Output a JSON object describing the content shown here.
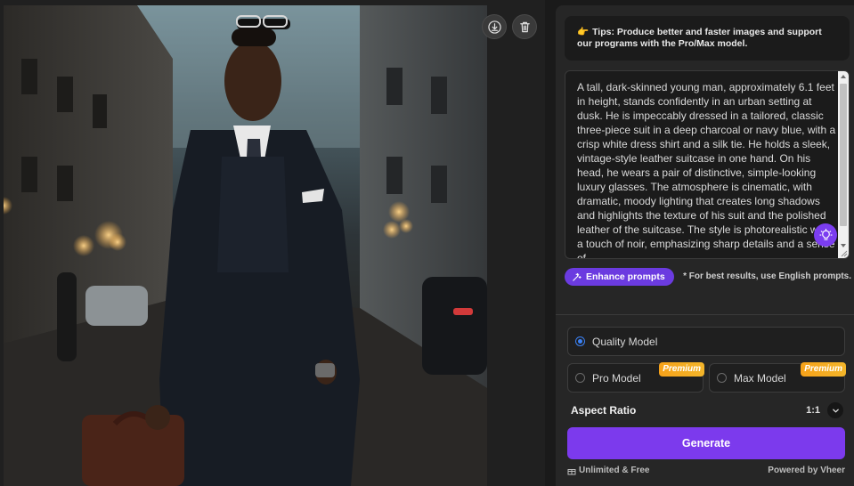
{
  "image": {
    "actions": {
      "download_icon": "download-icon",
      "delete_icon": "trash-icon"
    }
  },
  "tips": {
    "icon": "👉",
    "text": "Tips: Produce better and faster images and support our programs with the Pro/Max model."
  },
  "prompt": {
    "value": "A tall, dark-skinned young man, approximately 6.1 feet in height, stands confidently in an urban setting at dusk. He is impeccably dressed in a tailored, classic three-piece suit in a deep charcoal or navy blue, with a crisp white dress shirt and a silk tie. He holds a sleek, vintage-style leather suitcase in one hand. On his head, he wears a pair of distinctive, simple-looking luxury glasses. The atmosphere is cinematic, with dramatic, moody lighting that creates long shadows and highlights the texture of his suit and the polished leather of the suitcase. The style is photorealistic with a touch of noir, emphasizing sharp details and a sense of"
  },
  "enhance": {
    "label": "Enhance prompts",
    "hint": "* For best results, use English prompts."
  },
  "models": {
    "quality": {
      "label": "Quality Model",
      "selected": true
    },
    "pro": {
      "label": "Pro Model",
      "badge": "Premium"
    },
    "max": {
      "label": "Max Model",
      "badge": "Premium"
    }
  },
  "aspect": {
    "label": "Aspect Ratio",
    "value": "1:1"
  },
  "generate": {
    "label": "Generate"
  },
  "footer": {
    "left": "Unlimited & Free",
    "right": "Powered by Vheer"
  },
  "colors": {
    "accent": "#7c3aed",
    "radio": "#3b82f6",
    "badge": "#f6a21a"
  }
}
